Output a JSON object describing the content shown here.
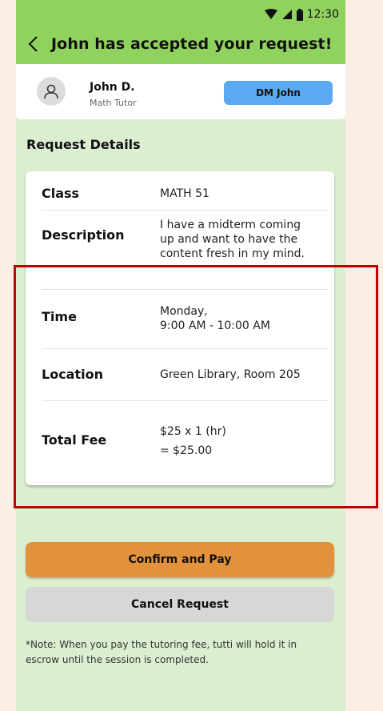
{
  "status_bar": {
    "time": "12:30"
  },
  "header": {
    "title": "John has accepted your request!"
  },
  "tutor": {
    "name": "John D.",
    "role": "Math Tutor",
    "dm_label": "DM John"
  },
  "section": {
    "title": "Request Details"
  },
  "details": {
    "class_label": "Class",
    "class_value": "MATH 51",
    "description_label": "Description",
    "description_lines": [
      "I have a midterm coming",
      "up and want to have the",
      "content fresh in my mind."
    ],
    "time_label": "Time",
    "time_lines": [
      "Monday,",
      "9:00 AM - 10:00 AM"
    ],
    "location_label": "Location",
    "location_value": "Green Library, Room 205",
    "fee_label": "Total Fee",
    "fee_lines": [
      "$25 x 1 (hr)",
      "= $25.00"
    ]
  },
  "actions": {
    "confirm_label": "Confirm and Pay",
    "cancel_label": "Cancel Request"
  },
  "note": {
    "lines": [
      "*Note: When you pay the tutoring fee, tutti will hold it in",
      "escrow until the session is completed."
    ]
  },
  "colors": {
    "page_bg": "#fbeee5",
    "screen_bg": "#dbeed0",
    "header_green": "#8fd35e",
    "dm_blue": "#5aa9f2",
    "confirm_orange": "#e2923c",
    "cancel_gray": "#d7d7d7",
    "highlight_red": "#c00000"
  },
  "icons": [
    "wifi-icon",
    "signal-icon",
    "battery-icon",
    "back-chevron-icon",
    "user-avatar-icon"
  ]
}
